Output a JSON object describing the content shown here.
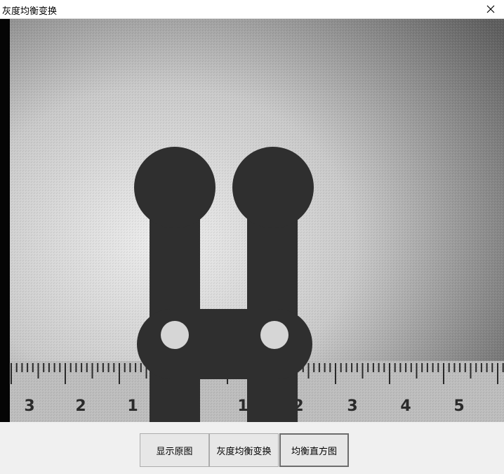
{
  "window": {
    "title": "灰度均衡变换",
    "close_label": "×"
  },
  "image": {
    "ruler_numbers": [
      "3",
      "2",
      "1",
      "1",
      "2",
      "3",
      "4",
      "5"
    ]
  },
  "buttons": {
    "show_original": "显示原图",
    "equalize": "灰度均衡变换",
    "histogram": "均衡直方图"
  }
}
